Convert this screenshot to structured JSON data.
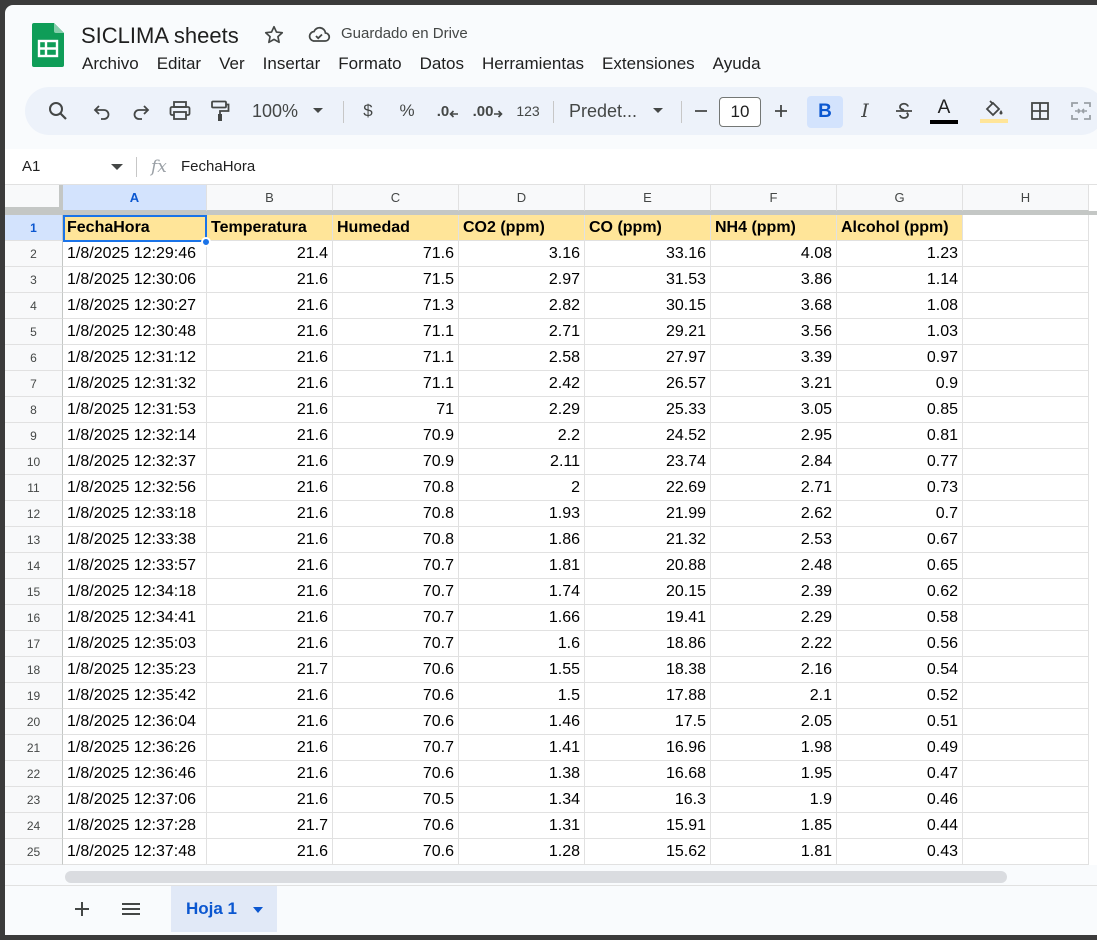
{
  "app": {
    "title": "SICLIMA sheets",
    "save_status": "Guardado en Drive"
  },
  "menu": [
    "Archivo",
    "Editar",
    "Ver",
    "Insertar",
    "Formato",
    "Datos",
    "Herramientas",
    "Extensiones",
    "Ayuda"
  ],
  "toolbar": {
    "zoom": "100%",
    "currency": "$",
    "percent": "%",
    "dec_decrease": ".0",
    "dec_increase": ".00",
    "more_formats": "123",
    "font": "Predet...",
    "font_size": "10",
    "bold": "B",
    "italic": "I",
    "text_color_letter": "A"
  },
  "formula_bar": {
    "name_box": "A1",
    "fx": "fx",
    "content": "FechaHora"
  },
  "columns": [
    "A",
    "B",
    "C",
    "D",
    "E",
    "F",
    "G",
    "H"
  ],
  "header_row": [
    "FechaHora",
    "Temperatura",
    "Humedad",
    "CO2 (ppm)",
    "CO (ppm)",
    "NH4 (ppm)",
    "Alcohol (ppm)"
  ],
  "rows": [
    [
      "1/8/2025 12:29:46",
      "21.4",
      "71.6",
      "3.16",
      "33.16",
      "4.08",
      "1.23"
    ],
    [
      "1/8/2025 12:30:06",
      "21.6",
      "71.5",
      "2.97",
      "31.53",
      "3.86",
      "1.14"
    ],
    [
      "1/8/2025 12:30:27",
      "21.6",
      "71.3",
      "2.82",
      "30.15",
      "3.68",
      "1.08"
    ],
    [
      "1/8/2025 12:30:48",
      "21.6",
      "71.1",
      "2.71",
      "29.21",
      "3.56",
      "1.03"
    ],
    [
      "1/8/2025 12:31:12",
      "21.6",
      "71.1",
      "2.58",
      "27.97",
      "3.39",
      "0.97"
    ],
    [
      "1/8/2025 12:31:32",
      "21.6",
      "71.1",
      "2.42",
      "26.57",
      "3.21",
      "0.9"
    ],
    [
      "1/8/2025 12:31:53",
      "21.6",
      "71",
      "2.29",
      "25.33",
      "3.05",
      "0.85"
    ],
    [
      "1/8/2025 12:32:14",
      "21.6",
      "70.9",
      "2.2",
      "24.52",
      "2.95",
      "0.81"
    ],
    [
      "1/8/2025 12:32:37",
      "21.6",
      "70.9",
      "2.11",
      "23.74",
      "2.84",
      "0.77"
    ],
    [
      "1/8/2025 12:32:56",
      "21.6",
      "70.8",
      "2",
      "22.69",
      "2.71",
      "0.73"
    ],
    [
      "1/8/2025 12:33:18",
      "21.6",
      "70.8",
      "1.93",
      "21.99",
      "2.62",
      "0.7"
    ],
    [
      "1/8/2025 12:33:38",
      "21.6",
      "70.8",
      "1.86",
      "21.32",
      "2.53",
      "0.67"
    ],
    [
      "1/8/2025 12:33:57",
      "21.6",
      "70.7",
      "1.81",
      "20.88",
      "2.48",
      "0.65"
    ],
    [
      "1/8/2025 12:34:18",
      "21.6",
      "70.7",
      "1.74",
      "20.15",
      "2.39",
      "0.62"
    ],
    [
      "1/8/2025 12:34:41",
      "21.6",
      "70.7",
      "1.66",
      "19.41",
      "2.29",
      "0.58"
    ],
    [
      "1/8/2025 12:35:03",
      "21.6",
      "70.7",
      "1.6",
      "18.86",
      "2.22",
      "0.56"
    ],
    [
      "1/8/2025 12:35:23",
      "21.7",
      "70.6",
      "1.55",
      "18.38",
      "2.16",
      "0.54"
    ],
    [
      "1/8/2025 12:35:42",
      "21.6",
      "70.6",
      "1.5",
      "17.88",
      "2.1",
      "0.52"
    ],
    [
      "1/8/2025 12:36:04",
      "21.6",
      "70.6",
      "1.46",
      "17.5",
      "2.05",
      "0.51"
    ],
    [
      "1/8/2025 12:36:26",
      "21.6",
      "70.7",
      "1.41",
      "16.96",
      "1.98",
      "0.49"
    ],
    [
      "1/8/2025 12:36:46",
      "21.6",
      "70.6",
      "1.38",
      "16.68",
      "1.95",
      "0.47"
    ],
    [
      "1/8/2025 12:37:06",
      "21.6",
      "70.5",
      "1.34",
      "16.3",
      "1.9",
      "0.46"
    ],
    [
      "1/8/2025 12:37:28",
      "21.7",
      "70.6",
      "1.31",
      "15.91",
      "1.85",
      "0.44"
    ],
    [
      "1/8/2025 12:37:48",
      "21.6",
      "70.6",
      "1.28",
      "15.62",
      "1.81",
      "0.43"
    ]
  ],
  "sheet_tab": "Hoja 1",
  "colors": {
    "header_fill": "#ffe599",
    "selection": "#1a73e8",
    "sheets_green": "#0f9d58"
  }
}
